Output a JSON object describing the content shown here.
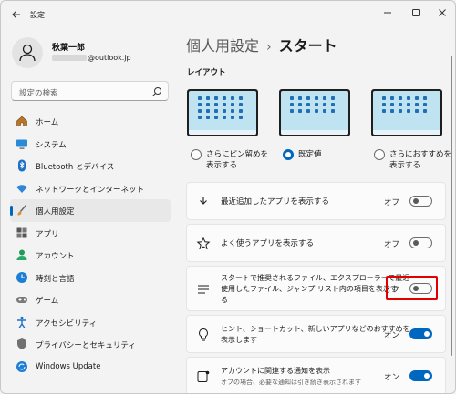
{
  "window": {
    "title": "設定"
  },
  "profile": {
    "name": "秋葉一郎",
    "email_suffix": "@outlook.jp"
  },
  "search": {
    "placeholder": "設定の検索"
  },
  "nav": [
    {
      "label": "ホーム",
      "icon": "home-icon"
    },
    {
      "label": "システム",
      "icon": "monitor-icon"
    },
    {
      "label": "Bluetooth とデバイス",
      "icon": "bluetooth-icon"
    },
    {
      "label": "ネットワークとインターネット",
      "icon": "wifi-icon"
    },
    {
      "label": "個人用設定",
      "icon": "brush-icon",
      "active": true
    },
    {
      "label": "アプリ",
      "icon": "apps-icon"
    },
    {
      "label": "アカウント",
      "icon": "account-icon"
    },
    {
      "label": "時刻と言語",
      "icon": "clock-globe-icon"
    },
    {
      "label": "ゲーム",
      "icon": "gamepad-icon"
    },
    {
      "label": "アクセシビリティ",
      "icon": "accessibility-icon"
    },
    {
      "label": "プライバシーとセキュリティ",
      "icon": "shield-icon"
    },
    {
      "label": "Windows Update",
      "icon": "update-icon"
    }
  ],
  "breadcrumb": {
    "parent": "個人用設定",
    "separator": "›",
    "current": "スタート"
  },
  "layout_section": {
    "label": "レイアウト",
    "options": [
      {
        "line1": "さらにピン留めを",
        "line2": "表示する",
        "selected": false
      },
      {
        "line1": "既定値",
        "line2": "",
        "selected": true
      },
      {
        "line1": "さらにおすすめを",
        "line2": "表示する",
        "selected": false
      }
    ]
  },
  "settings": [
    {
      "line1": "最近追加したアプリを表示する",
      "line2": "",
      "state": "オフ",
      "on": false,
      "icon": "download-icon"
    },
    {
      "line1": "よく使うアプリを表示する",
      "line2": "",
      "state": "オフ",
      "on": false,
      "icon": "star-icon"
    },
    {
      "line1": "スタートで推奨されるファイル、エクスプローラーで最近",
      "line2": "使用したファイル、ジャンプ リスト内の項目を表示す",
      "line3": "る",
      "state": "オフ",
      "on": false,
      "icon": "list-icon"
    },
    {
      "line1": "ヒント、ショートカット、新しいアプリなどのおすすめを",
      "line2": "表示します",
      "state": "オン",
      "on": true,
      "icon": "lightbulb-icon"
    },
    {
      "line1": "アカウントに関連する通知を表示",
      "line2": "オフの場合、必要な通知は引き続き表示されます",
      "state": "オン",
      "on": true,
      "icon": "notification-icon"
    }
  ],
  "colors": {
    "accent": "#0067c0",
    "highlight": "#e00000"
  }
}
